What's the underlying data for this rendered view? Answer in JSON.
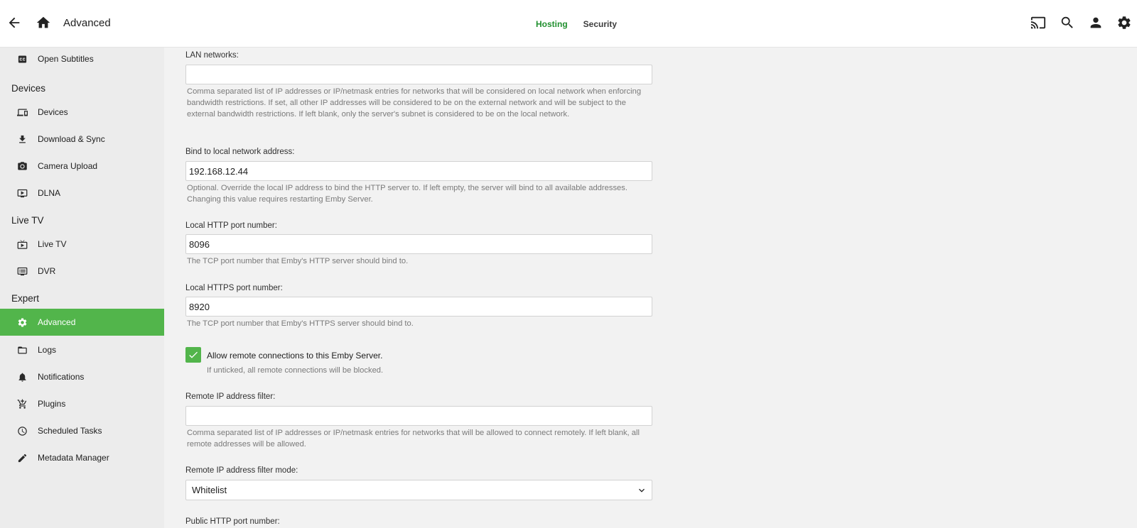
{
  "header": {
    "title": "Advanced",
    "tabs": [
      {
        "label": "Hosting",
        "active": true
      },
      {
        "label": "Security",
        "active": false
      }
    ],
    "icons": [
      "back-arrow-icon",
      "home-icon",
      "cast-icon",
      "search-icon",
      "user-icon",
      "settings-icon"
    ]
  },
  "sidebar": {
    "items_top": [
      {
        "label": "Open Subtitles",
        "icon": "closed-captions-icon"
      }
    ],
    "sections": {
      "devices": "Devices",
      "live_tv": "Live TV",
      "expert": "Expert"
    },
    "devices": [
      {
        "label": "Devices",
        "icon": "devices-icon"
      },
      {
        "label": "Download & Sync",
        "icon": "download-icon"
      },
      {
        "label": "Camera Upload",
        "icon": "camera-icon"
      },
      {
        "label": "DLNA",
        "icon": "dlna-icon"
      }
    ],
    "live_tv": [
      {
        "label": "Live TV",
        "icon": "live-tv-icon"
      },
      {
        "label": "DVR",
        "icon": "dvr-icon"
      }
    ],
    "expert": [
      {
        "label": "Advanced",
        "icon": "gear-icon",
        "active": true
      },
      {
        "label": "Logs",
        "icon": "folder-icon"
      },
      {
        "label": "Notifications",
        "icon": "bell-icon"
      },
      {
        "label": "Plugins",
        "icon": "cart-icon"
      },
      {
        "label": "Scheduled Tasks",
        "icon": "clock-icon"
      },
      {
        "label": "Metadata Manager",
        "icon": "pencil-icon"
      }
    ]
  },
  "form": {
    "lan_networks": {
      "label": "LAN networks:",
      "value": "",
      "help": "Comma separated list of IP addresses or IP/netmask entries for networks that will be considered on local network when enforcing bandwidth restrictions. If set, all other IP addresses will be considered to be on the external network and will be subject to the external bandwidth restrictions. If left blank, only the server's subnet is considered to be on the local network."
    },
    "bind_address": {
      "label": "Bind to local network address:",
      "value": "192.168.12.44",
      "help": "Optional. Override the local IP address to bind the HTTP server to. If left empty, the server will bind to all available addresses. Changing this value requires restarting Emby Server."
    },
    "http_port": {
      "label": "Local HTTP port number:",
      "value": "8096",
      "help": "The TCP port number that Emby's HTTP server should bind to."
    },
    "https_port": {
      "label": "Local HTTPS port number:",
      "value": "8920",
      "help": "The TCP port number that Emby's HTTPS server should bind to."
    },
    "allow_remote": {
      "label": "Allow remote connections to this Emby Server.",
      "checked": true,
      "help": "If unticked, all remote connections will be blocked."
    },
    "remote_ip_filter": {
      "label": "Remote IP address filter:",
      "value": "",
      "help": "Comma separated list of IP addresses or IP/netmask entries for networks that will be allowed to connect remotely. If left blank, all remote addresses will be allowed."
    },
    "remote_ip_filter_mode": {
      "label": "Remote IP address filter mode:",
      "value": "Whitelist"
    },
    "public_http_port": {
      "label": "Public HTTP port number:"
    }
  },
  "colors": {
    "accent": "#52b54b",
    "active_tab": "#21902f"
  }
}
